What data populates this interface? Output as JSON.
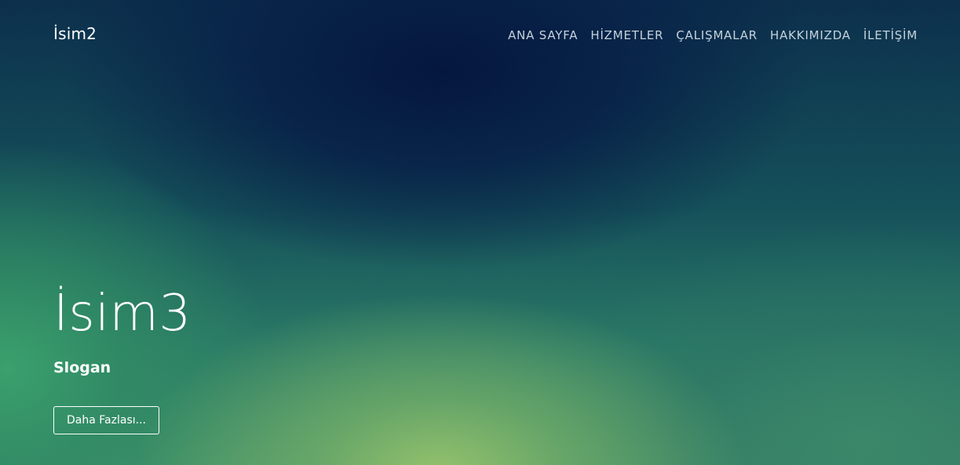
{
  "navbar": {
    "brand": "İsim2",
    "items": [
      {
        "label": "ANA SAYFA"
      },
      {
        "label": "HİZMETLER"
      },
      {
        "label": "ÇALIŞMALAR"
      },
      {
        "label": "HAKKIMIZDA"
      },
      {
        "label": "İLETİŞİM"
      }
    ]
  },
  "hero": {
    "title": "İsim3",
    "slogan": "Slogan",
    "button_label": "Daha Fazlası..."
  },
  "colors": {
    "top_background": "#04163e",
    "bottom_left_green": "#3aa06c",
    "bottom_center_light": "#98c46c",
    "nav_text": "#c4d2dc",
    "text": "#ffffff"
  }
}
